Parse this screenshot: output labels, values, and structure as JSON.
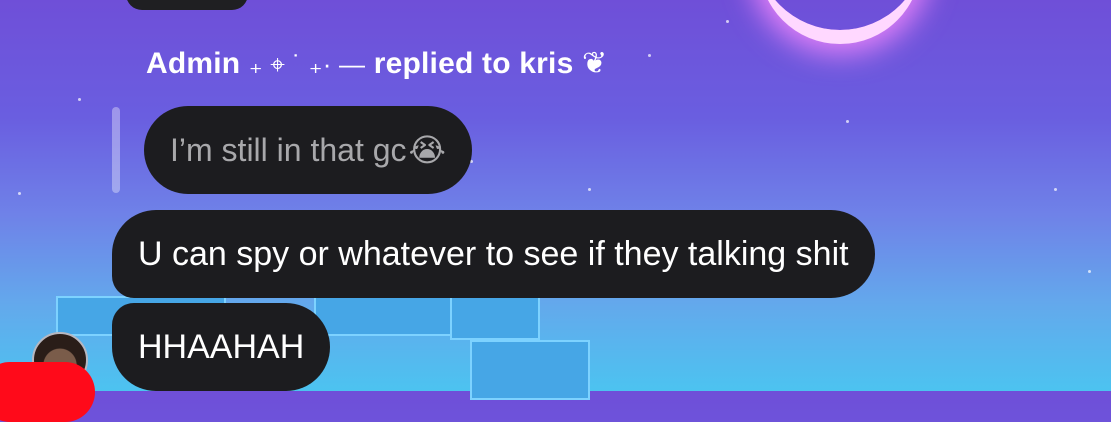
{
  "reply": {
    "sender": "Admin",
    "decoration": "₊ ⌖ ˙ ₊· —",
    "action_text": "replied to kris",
    "heart": "❦"
  },
  "quoted_message": {
    "text": "I’m still in that gc",
    "emoji": "😭"
  },
  "messages": [
    {
      "text": "U can spy or whatever to see if they talking shit"
    },
    {
      "text": "HHAAHAH"
    }
  ],
  "colors": {
    "bubble": "#1c1c1f",
    "quoted_text": "#a8a8ab",
    "accent_badge": "#ff0a1a"
  },
  "icons": {
    "avatar": "profile-avatar",
    "badge": "notification-badge"
  }
}
